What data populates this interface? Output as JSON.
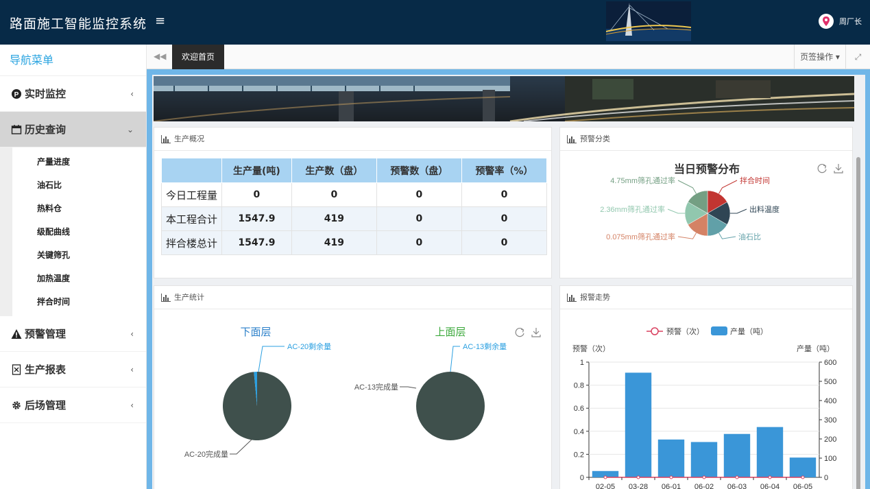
{
  "app": {
    "title": "路面施工智能监控系统",
    "user_name": "周厂长"
  },
  "sidebar": {
    "header": "导航菜单",
    "items": [
      {
        "label": "实时监控",
        "icon": "parking-icon"
      },
      {
        "label": "历史查询",
        "icon": "calendar-icon",
        "active": true
      },
      {
        "label": "预警管理",
        "icon": "warning-icon"
      },
      {
        "label": "生产报表",
        "icon": "report-icon"
      },
      {
        "label": "后场管理",
        "icon": "gear-icon"
      }
    ],
    "submenu": [
      "产量进度",
      "油石比",
      "热料仓",
      "级配曲线",
      "关键筛孔",
      "加热温度",
      "拌合时间"
    ]
  },
  "tabs": {
    "active": "欢迎首页",
    "ops": "页签操作"
  },
  "production_overview": {
    "title": "生产概况",
    "columns": [
      "",
      "生产量(吨)",
      "生产数（盘）",
      "预警数（盘）",
      "预警率（%）"
    ],
    "rows": [
      [
        "今日工程量",
        "0",
        "0",
        "0",
        "0"
      ],
      [
        "本工程合计",
        "1547.9",
        "419",
        "0",
        "0"
      ],
      [
        "拌合楼总计",
        "1547.9",
        "419",
        "0",
        "0"
      ]
    ]
  },
  "warning_category": {
    "title": "预警分类",
    "chart_data": {
      "type": "pie",
      "title": "当日预警分布",
      "slices": [
        {
          "label": "拌合时间",
          "value": 1,
          "color": "#c23531"
        },
        {
          "label": "出料温度",
          "value": 1,
          "color": "#2f4554"
        },
        {
          "label": "油石比",
          "value": 1,
          "color": "#61a0a8"
        },
        {
          "label": "0.075mm筛孔通过率",
          "value": 1,
          "color": "#d48265"
        },
        {
          "label": "2.36mm筛孔通过率",
          "value": 1,
          "color": "#91c7ae"
        },
        {
          "label": "4.75mm筛孔通过率",
          "value": 1,
          "color": "#749f83"
        }
      ]
    }
  },
  "production_stats": {
    "title": "生产统计",
    "chart_data": [
      {
        "type": "pie",
        "title": "下面层",
        "slices": [
          {
            "label": "AC-20完成量",
            "value": 98.5,
            "color": "#3f504c"
          },
          {
            "label": "AC-20剩余量",
            "value": 1.5,
            "color": "#2a9fe0"
          }
        ]
      },
      {
        "type": "pie",
        "title": "上面层",
        "slices": [
          {
            "label": "AC-13完成量",
            "value": 100,
            "color": "#3f504c"
          },
          {
            "label": "AC-13剩余量",
            "value": 0,
            "color": "#2a9fe0"
          }
        ]
      }
    ]
  },
  "alarm_trend": {
    "title": "报警走势",
    "chart_data": {
      "type": "bar",
      "categories": [
        "02-05",
        "03-28",
        "06-01",
        "06-02",
        "06-03",
        "06-04",
        "06-05"
      ],
      "series": [
        {
          "name": "预警（次）",
          "kind": "line",
          "axis": "left",
          "values": [
            0,
            0,
            0,
            0,
            0,
            0,
            0
          ]
        },
        {
          "name": "产量（吨）",
          "kind": "bar",
          "axis": "right",
          "values": [
            33,
            545,
            197,
            184,
            226,
            262,
            103
          ]
        }
      ],
      "ylabel": "预警（次）",
      "ylabel_right": "产量（吨）",
      "ylim": [
        0,
        1
      ],
      "yticks": [
        "0",
        "0.2",
        "0.4",
        "0.6",
        "0.8",
        "1"
      ],
      "ylim_right": [
        0,
        600
      ],
      "yticks_right": [
        "0",
        "100",
        "200",
        "300",
        "400",
        "500",
        "600"
      ],
      "legend": "top-center"
    }
  }
}
